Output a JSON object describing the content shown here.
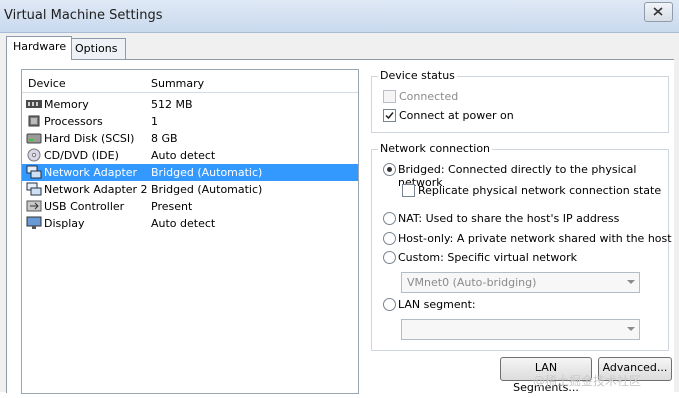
{
  "window": {
    "title": "Virtual Machine Settings"
  },
  "tabs": [
    {
      "label": "Hardware"
    },
    {
      "label": "Options"
    }
  ],
  "devices": {
    "header": {
      "device": "Device",
      "summary": "Summary"
    },
    "rows": [
      {
        "name": "Memory",
        "summary": "512 MB",
        "icon": "memory-icon"
      },
      {
        "name": "Processors",
        "summary": "1",
        "icon": "processor-icon"
      },
      {
        "name": "Hard Disk (SCSI)",
        "summary": "8 GB",
        "icon": "hard-disk-icon"
      },
      {
        "name": "CD/DVD (IDE)",
        "summary": "Auto detect",
        "icon": "cd-dvd-icon"
      },
      {
        "name": "Network Adapter",
        "summary": "Bridged (Automatic)",
        "icon": "network-adapter-icon"
      },
      {
        "name": "Network Adapter 2",
        "summary": "Bridged (Automatic)",
        "icon": "network-adapter-icon"
      },
      {
        "name": "USB Controller",
        "summary": "Present",
        "icon": "usb-icon"
      },
      {
        "name": "Display",
        "summary": "Auto detect",
        "icon": "display-icon"
      }
    ],
    "selected_index": 4
  },
  "device_status": {
    "legend": "Device status",
    "connected": {
      "label": "Connected",
      "checked": false,
      "enabled": false
    },
    "connect_at_power_on": {
      "label": "Connect at power on",
      "checked": true
    }
  },
  "network_connection": {
    "legend": "Network connection",
    "bridged": {
      "label": "Bridged: Connected directly to the physical network",
      "selected": true
    },
    "replicate": {
      "label": "Replicate physical network connection state",
      "checked": false
    },
    "nat": {
      "label": "NAT: Used to share the host's IP address"
    },
    "host_only": {
      "label": "Host-only: A private network shared with the host"
    },
    "custom": {
      "label": "Custom: Specific virtual network",
      "select_value": "VMnet0 (Auto-bridging)"
    },
    "lan_segment": {
      "label": "LAN segment:",
      "select_value": ""
    }
  },
  "buttons": {
    "lan_segments": "LAN Segments...",
    "advanced": "Advanced..."
  },
  "watermark": "@稀土掘金技术社区",
  "colors": {
    "selection": "#3399ff",
    "titlebar": "#c9d9ee"
  }
}
